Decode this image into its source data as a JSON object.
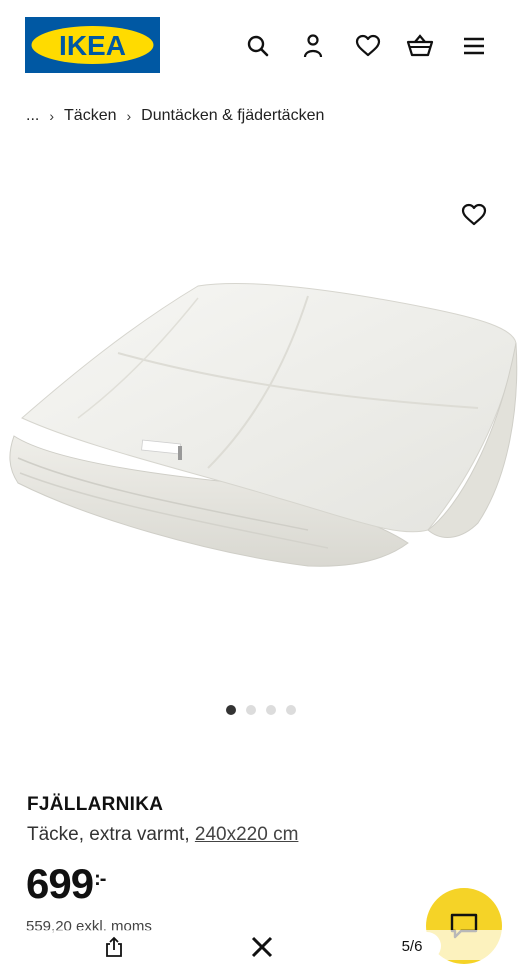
{
  "brand": {
    "logo_text": "IKEA",
    "blue": "#0058a3",
    "yellow": "#ffdb00"
  },
  "header_icons": [
    "search-icon",
    "user-icon",
    "heart-icon",
    "cart-icon",
    "menu-icon"
  ],
  "breadcrumb": {
    "ellipsis": "...",
    "separator": "›",
    "items": [
      "Täcken",
      "Duntäcken & fjädertäcken"
    ]
  },
  "product": {
    "name": "FJÄLLARNIKA",
    "desc": "Täcke, extra varmt,",
    "size": "240x220 cm",
    "price": "699",
    "price_suffix": ":-",
    "price_ex_vat": "559,20 exkl. moms"
  },
  "carousel": {
    "count": 4,
    "active": 1
  },
  "viewer": {
    "counter": "5/6"
  },
  "colors": {
    "chat_button": "#f5d327"
  }
}
